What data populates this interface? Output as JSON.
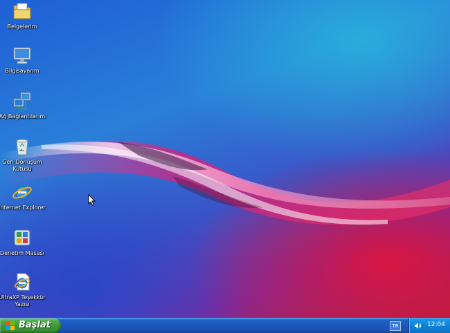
{
  "desktop": {
    "icons": [
      {
        "label": "Belgelerim",
        "icon": "folder-documents-icon"
      },
      {
        "label": "Bilgisayarım",
        "icon": "computer-monitor-icon"
      },
      {
        "label": "Ağ Bağlantılarım",
        "icon": "network-connections-icon"
      },
      {
        "label": "Geri Dönüşüm Kutusu",
        "icon": "recycle-bin-icon"
      },
      {
        "label": "Internet Explorer",
        "icon": "internet-explorer-icon"
      },
      {
        "label": "Denetim Masası",
        "icon": "control-panel-icon"
      },
      {
        "label": "UltraXP Teşekkür Yazısı",
        "icon": "ie-document-icon"
      }
    ]
  },
  "taskbar": {
    "start_label": "Başlat",
    "language": "TR",
    "clock": "12:04"
  },
  "colors": {
    "taskbar_blue": "#1c56b8",
    "start_green": "#3d9c3a",
    "tray_blue": "#0f82d8"
  }
}
